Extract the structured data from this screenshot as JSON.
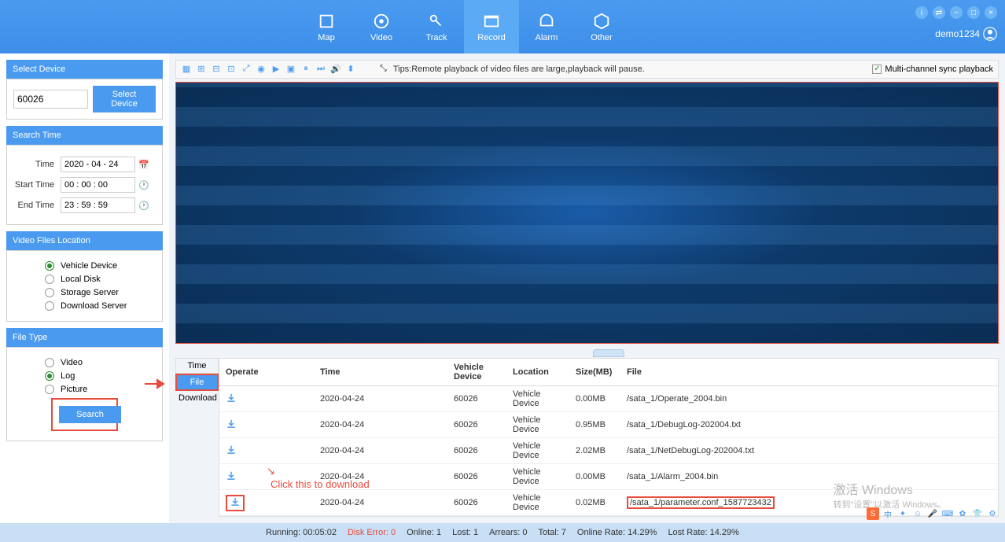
{
  "header": {
    "tabs": [
      {
        "id": "map",
        "label": "Map"
      },
      {
        "id": "video",
        "label": "Video"
      },
      {
        "id": "track",
        "label": "Track"
      },
      {
        "id": "record",
        "label": "Record",
        "active": true
      },
      {
        "id": "alarm",
        "label": "Alarm"
      },
      {
        "id": "other",
        "label": "Other"
      }
    ],
    "username": "demo1234"
  },
  "sidebar": {
    "select_device": {
      "title": "Select Device",
      "value": "60026",
      "button": "Select Device"
    },
    "search_time": {
      "title": "Search Time",
      "time_label": "Time",
      "time_value": "2020 - 04 - 24",
      "start_label": "Start Time",
      "start_value": "00 : 00 : 00",
      "end_label": "End Time",
      "end_value": "23 : 59 : 59"
    },
    "location": {
      "title": "Video Files Location",
      "options": [
        "Vehicle Device",
        "Local Disk",
        "Storage Server",
        "Download Server"
      ],
      "selected": "Vehicle Device"
    },
    "file_type": {
      "title": "File Type",
      "options": [
        "Video",
        "Log",
        "Picture"
      ],
      "selected": "Log"
    },
    "search_button": "Search"
  },
  "toolbar": {
    "tip": "Tips:Remote playback of video files are large,playback will pause.",
    "sync_label": "Multi-channel sync playback"
  },
  "table": {
    "tabs": [
      "Time",
      "File",
      "Download"
    ],
    "active_tab": "File",
    "columns": [
      "Operate",
      "Time",
      "Vehicle Device",
      "Location",
      "Size(MB)",
      "File"
    ],
    "rows": [
      {
        "time": "2020-04-24",
        "device": "60026",
        "location": "Vehicle Device",
        "size": "0.00MB",
        "file": "/sata_1/Operate_2004.bin"
      },
      {
        "time": "2020-04-24",
        "device": "60026",
        "location": "Vehicle Device",
        "size": "0.95MB",
        "file": "/sata_1/DebugLog-202004.txt"
      },
      {
        "time": "2020-04-24",
        "device": "60026",
        "location": "Vehicle Device",
        "size": "2.02MB",
        "file": "/sata_1/NetDebugLog-202004.txt"
      },
      {
        "time": "2020-04-24",
        "device": "60026",
        "location": "Vehicle Device",
        "size": "0.00MB",
        "file": "/sata_1/Alarm_2004.bin"
      },
      {
        "time": "2020-04-24",
        "device": "60026",
        "location": "Vehicle Device",
        "size": "0.02MB",
        "file": "/sata_1/parameter.conf_1587723432"
      }
    ]
  },
  "annotation": {
    "download_text": "Click this to download"
  },
  "statusbar": {
    "running_label": "Running:",
    "running_value": "00:05:02",
    "disk_error": "Disk Error:  0",
    "online": "Online:  1",
    "lost": "Lost:  1",
    "arrears": "Arrears:  0",
    "total": "Total:  7",
    "online_rate": "Online Rate:  14.29%",
    "lost_rate": "Lost Rate:  14.29%"
  },
  "watermark": {
    "line1": "激活 Windows",
    "line2": "转到\"设置\"以激活 Windows。"
  }
}
